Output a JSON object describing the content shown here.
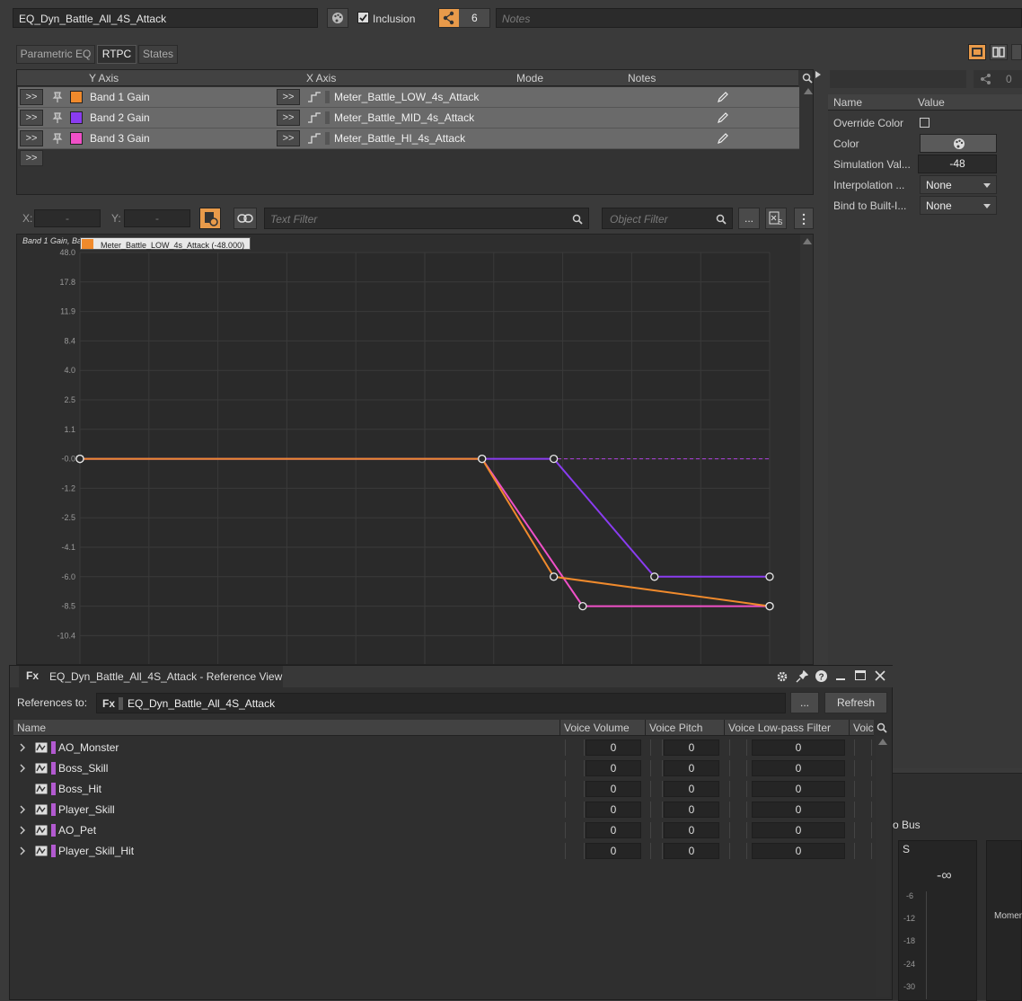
{
  "title_bar": {
    "object_name": "EQ_Dyn_Battle_All_4S_Attack",
    "inclusion_label": "Inclusion",
    "share_count": "6",
    "notes_placeholder": "Notes"
  },
  "tabs": [
    "Parametric EQ",
    "RTPC",
    "States"
  ],
  "rtpc_table": {
    "headers": {
      "y_axis": "Y Axis",
      "x_axis": "X Axis",
      "mode": "Mode",
      "notes": "Notes"
    },
    "expand_label": ">>",
    "rows": [
      {
        "y": "Band 1 Gain",
        "x": "Meter_Battle_LOW_4s_Attack",
        "color": "#f08a2c"
      },
      {
        "y": "Band 2 Gain",
        "x": "Meter_Battle_MID_4s_Attack",
        "color": "#8a3cf0"
      },
      {
        "y": "Band 3 Gain",
        "x": "Meter_Battle_HI_4s_Attack",
        "color": "#f050c8"
      }
    ]
  },
  "graph_toolbar": {
    "x_label": "X:",
    "x_value": "-",
    "y_label": "Y:",
    "y_value": "-",
    "text_filter_placeholder": "Text Filter",
    "object_filter_placeholder": "Object Filter",
    "more_label": "..."
  },
  "graph": {
    "header_text": "Band 1 Gain, Ba",
    "legend_text": "Meter_Battle_LOW_4s_Attack (-48.000)",
    "y_ticks": [
      "48.0",
      "17.8",
      "11.9",
      "8.4",
      "4.0",
      "2.5",
      "1.1",
      "-0.0",
      "-1.2",
      "-2.5",
      "-4.1",
      "-6.0",
      "-8.5",
      "-10.4"
    ]
  },
  "chart_data": {
    "type": "line",
    "title": "",
    "ylabel": "",
    "y_scale": "nonlinear (per tick labels)",
    "series": [
      {
        "name": "Band 1 Gain",
        "color": "#f08a2c",
        "points": [
          [
            0,
            0
          ],
          [
            0.583,
            0
          ],
          [
            0.687,
            -6.0
          ],
          [
            1.0,
            -8.5
          ]
        ]
      },
      {
        "name": "Band 2 Gain",
        "color": "#8a3cf0",
        "points": [
          [
            0,
            0
          ],
          [
            0.687,
            0
          ],
          [
            0.833,
            -6.0
          ],
          [
            1.0,
            -6.0
          ]
        ]
      },
      {
        "name": "Band 3 Gain",
        "color": "#f050c8",
        "points": [
          [
            0,
            0
          ],
          [
            0.583,
            0
          ],
          [
            0.729,
            -8.5
          ],
          [
            1.0,
            -8.5
          ]
        ]
      }
    ]
  },
  "props_panel": {
    "headers": {
      "name": "Name",
      "value": "Value"
    },
    "share_count": "0",
    "rows": [
      {
        "name": "Override Color",
        "value": ""
      },
      {
        "name": "Color",
        "value": ""
      },
      {
        "name": "Simulation Val...",
        "value": "-48"
      },
      {
        "name": "Interpolation ...",
        "value": "None"
      },
      {
        "name": "Bind to Built-I...",
        "value": "None"
      }
    ]
  },
  "ref_view": {
    "title": "EQ_Dyn_Battle_All_4S_Attack - Reference View",
    "references_label": "References to:",
    "reference_name": "EQ_Dyn_Battle_All_4S_Attack",
    "more_label": "...",
    "refresh_label": "Refresh",
    "columns": [
      "Name",
      "Voice Volume",
      "Voice Pitch",
      "Voice Low-pass Filter",
      "Voic"
    ],
    "rows": [
      {
        "name": "AO_Monster",
        "expandable": true,
        "volume": "0",
        "pitch": "0",
        "lpf": "0"
      },
      {
        "name": "Boss_Skill",
        "expandable": true,
        "volume": "0",
        "pitch": "0",
        "lpf": "0"
      },
      {
        "name": "Boss_Hit",
        "expandable": false,
        "volume": "0",
        "pitch": "0",
        "lpf": "0"
      },
      {
        "name": "Player_Skill",
        "expandable": true,
        "volume": "0",
        "pitch": "0",
        "lpf": "0"
      },
      {
        "name": "AO_Pet",
        "expandable": true,
        "volume": "0",
        "pitch": "0",
        "lpf": "0"
      },
      {
        "name": "Player_Skill_Hit",
        "expandable": true,
        "volume": "0",
        "pitch": "0",
        "lpf": "0"
      }
    ]
  },
  "meter_panel": {
    "title": "o Bus",
    "solo_label": "S",
    "peak": "-∞",
    "ticks": [
      "-6",
      "-12",
      "-18",
      "-24",
      "-30"
    ],
    "side_label": "Momen"
  }
}
